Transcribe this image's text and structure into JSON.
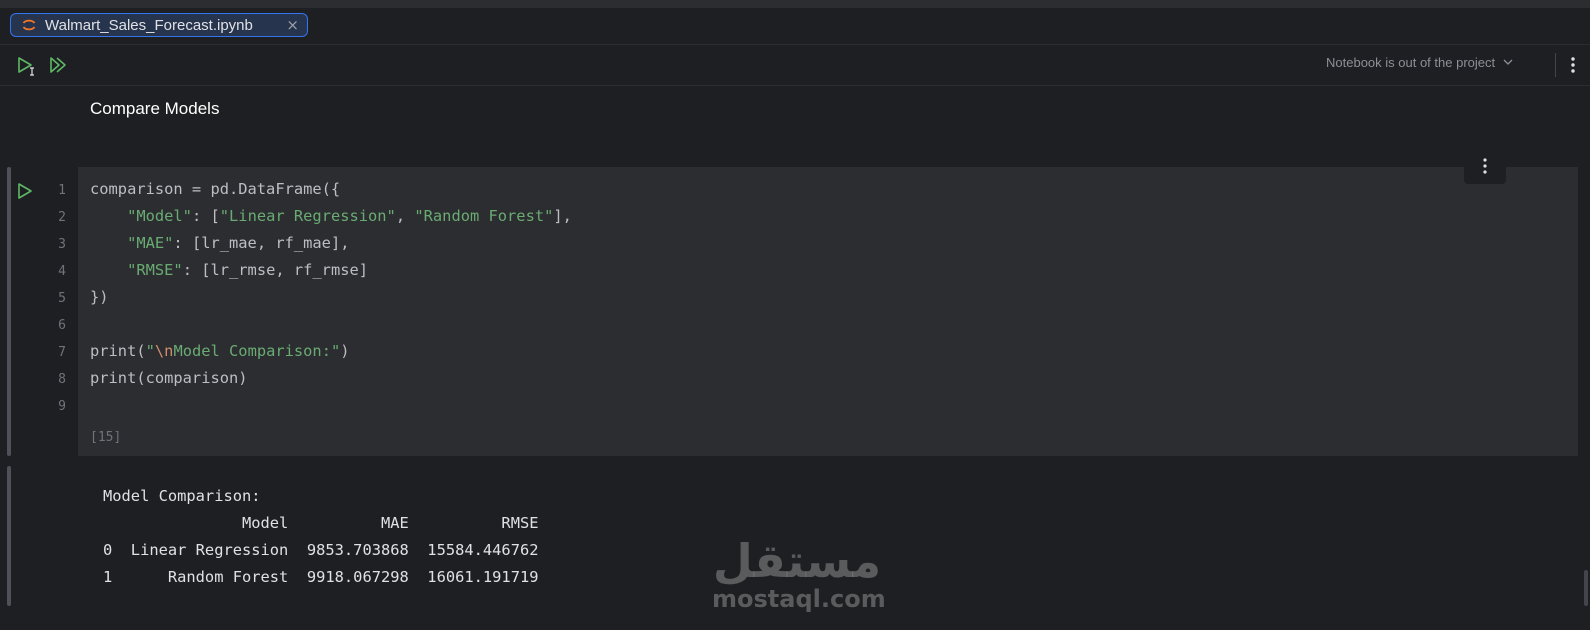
{
  "tab": {
    "title": "Walmart_Sales_Forecast.ipynb",
    "close_glyph": "×"
  },
  "toolbar": {
    "notebook_status": "Notebook is out of the project"
  },
  "markdown": {
    "heading": "Compare Models"
  },
  "cell": {
    "line_numbers": [
      "1",
      "2",
      "3",
      "4",
      "5",
      "6",
      "7",
      "8",
      "9"
    ],
    "execution_count": "[15]",
    "code": {
      "l1": "comparison = pd.DataFrame({",
      "l2_indent": "    ",
      "l2_key": "\"Model\"",
      "l2_mid": ": [",
      "l2_v1": "\"Linear Regression\"",
      "l2_sep": ", ",
      "l2_v2": "\"Random Forest\"",
      "l2_end": "],",
      "l3_indent": "    ",
      "l3_key": "\"MAE\"",
      "l3_rest": ": [lr_mae, rf_mae],",
      "l4_indent": "    ",
      "l4_key": "\"RMSE\"",
      "l4_rest": ": [lr_rmse, rf_rmse]",
      "l5": "})",
      "l7_pre": "print(",
      "l7_q": "\"",
      "l7_esc": "\\n",
      "l7_str": "Model Comparison:\"",
      "l7_end": ")",
      "l8": "print(comparison)"
    }
  },
  "output": {
    "lines": [
      "Model Comparison:",
      "               Model          MAE          RMSE",
      "0  Linear Regression  9853.703868  15584.446762",
      "1      Random Forest  9918.067298  16061.191719"
    ]
  },
  "watermark": {
    "arabic": "مستقل",
    "latin": "mostaql.com"
  },
  "colors": {
    "accent": "#3574f0",
    "run_green": "#5fb865",
    "string_green": "#6aab73",
    "escape_orange": "#cf8e6d",
    "cell_bg": "#2b2d30",
    "editor_bg": "#1e1f22"
  }
}
